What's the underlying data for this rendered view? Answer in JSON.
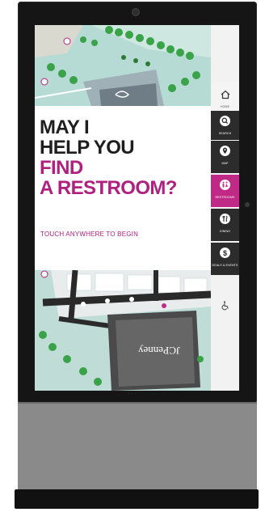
{
  "headline": {
    "line1": "MAY I",
    "line2": "HELP YOU",
    "line3": "FIND",
    "line4": "A RESTROOM?"
  },
  "cta_text": "TOUCH ANYWHERE TO BEGIN",
  "menu": {
    "home": {
      "icon": "home-icon",
      "label": "HOME"
    },
    "search": {
      "icon": "search-icon",
      "label": "SEARCH"
    },
    "map": {
      "icon": "map-pin-icon",
      "label": "MAP"
    },
    "restrooms": {
      "icon": "restroom-icon",
      "label": "RESTROOMS"
    },
    "dining": {
      "icon": "dining-icon",
      "label": "DINING"
    },
    "deals": {
      "icon": "dollar-icon",
      "label": "DEALS & EVENTS"
    },
    "accessibility": {
      "icon": "wheelchair-icon"
    }
  },
  "map_store_label": "JCPenney",
  "colors": {
    "accent": "#c02a86",
    "menu_dark": "#2c2c2c",
    "text_dark": "#1e1e1e",
    "map_bg": "#b9dcd5"
  }
}
